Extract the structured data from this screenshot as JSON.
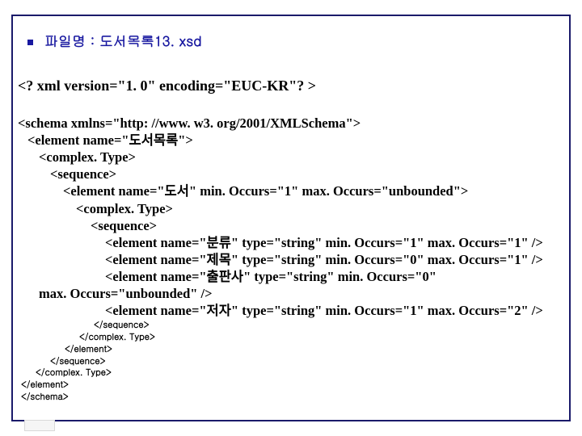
{
  "title": "파일명 : 도서목록13. xsd",
  "xml_declaration": "<? xml version=\"1. 0\" encoding=\"EUC-KR\"? >",
  "schema": {
    "l0": "<schema xmlns=\"http: //www. w3. org/2001/XMLSchema\">",
    "l1": "<element name=\"도서목록\">",
    "l2": "<complex. Type>",
    "l3": "<sequence>",
    "l4": "<element name=\"도서\" min. Occurs=\"1\" max. Occurs=\"unbounded\">",
    "l5": "<complex. Type>",
    "l6": "<sequence>",
    "l7": "<element name=\"분류\" type=\"string\" min. Occurs=\"1\" max. Occurs=\"1\" />",
    "l8": "<element name=\"제목\" type=\"string\" min. Occurs=\"0\" max. Occurs=\"1\" />",
    "l9a": "<element name=\"출판사\" type=\"string\" min. Occurs=\"0\"",
    "l9b": "max. Occurs=\"unbounded\" />",
    "l10": "<element name=\"저자\" type=\"string\" min. Occurs=\"1\" max. Occurs=\"2\" />"
  },
  "closing": {
    "c1": "</sequence>",
    "c2": "</complex. Type>",
    "c3": "</element>",
    "c4": "</sequence>",
    "c5": "</complex. Type>",
    "c6": "</element>",
    "c7": "</schema>"
  }
}
